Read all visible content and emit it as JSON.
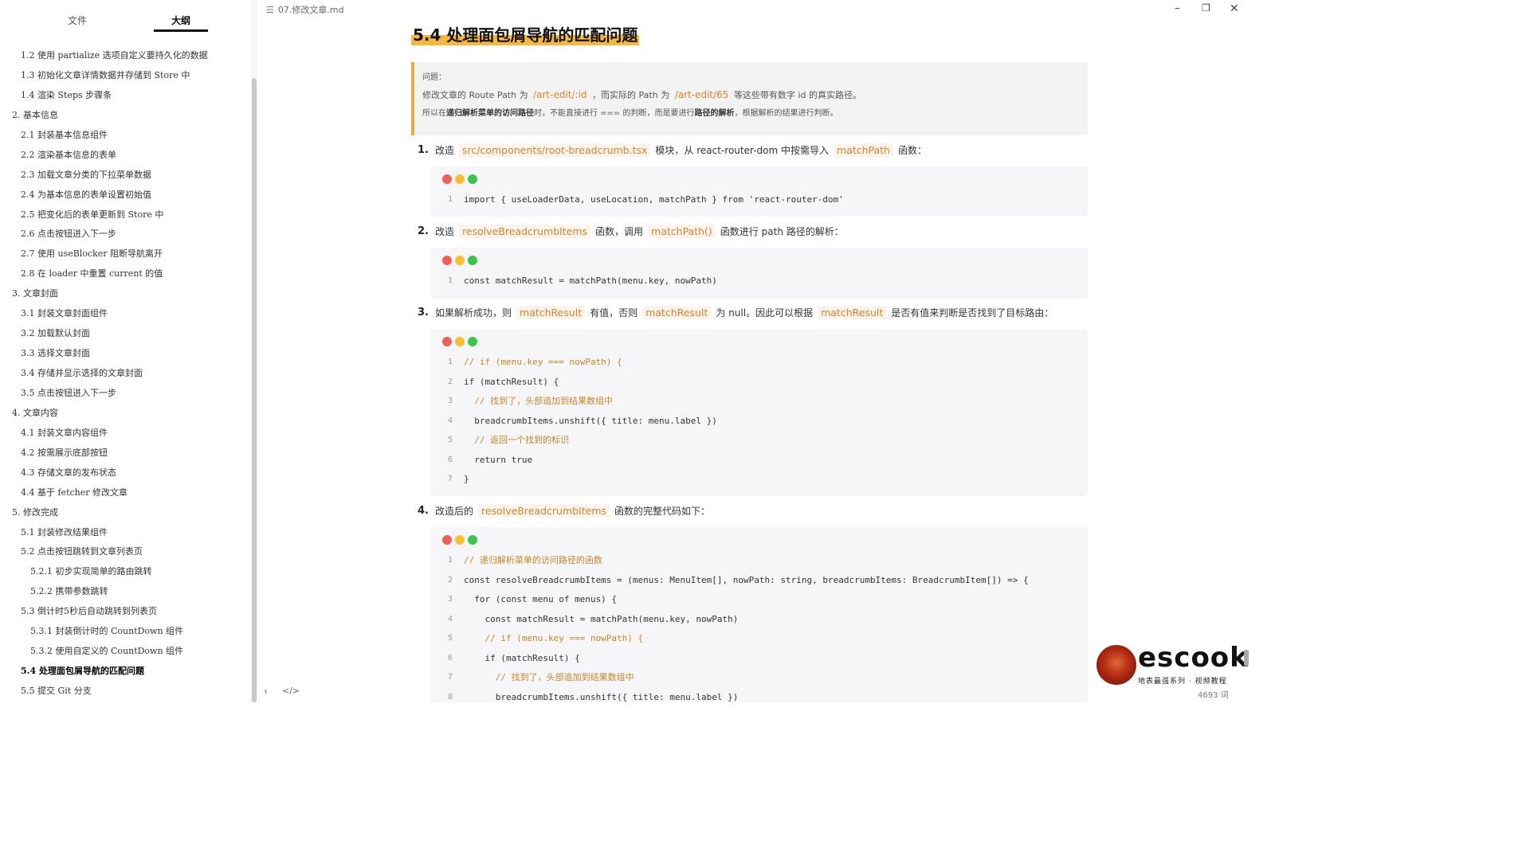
{
  "titlebar": {
    "file_name": "07.修改文章.md",
    "minimize_glyph": "–",
    "maximize_glyph": "❐",
    "close_glyph": "✕"
  },
  "sidebar": {
    "tab_files": "文件",
    "tab_outline": "大纲",
    "items": [
      {
        "label": "1.2 使用 partialize 选项自定义要持久化的数据",
        "level": 2
      },
      {
        "label": "1.3 初始化文章详情数据并存储到 Store 中",
        "level": 2
      },
      {
        "label": "1.4 渲染 Steps 步骤条",
        "level": 2
      },
      {
        "label": "2. 基本信息",
        "level": 1
      },
      {
        "label": "2.1 封装基本信息组件",
        "level": 2
      },
      {
        "label": "2.2 渲染基本信息的表单",
        "level": 2
      },
      {
        "label": "2.3 加载文章分类的下拉菜单数据",
        "level": 2
      },
      {
        "label": "2.4 为基本信息的表单设置初始值",
        "level": 2
      },
      {
        "label": "2.5 把变化后的表单更新到 Store 中",
        "level": 2
      },
      {
        "label": "2.6 点击按钮进入下一步",
        "level": 2
      },
      {
        "label": "2.7 使用 useBlocker 阻断导航离开",
        "level": 2
      },
      {
        "label": "2.8 在 loader 中重置 current 的值",
        "level": 2
      },
      {
        "label": "3. 文章封面",
        "level": 1
      },
      {
        "label": "3.1 封装文章封面组件",
        "level": 2
      },
      {
        "label": "3.2 加载默认封面",
        "level": 2
      },
      {
        "label": "3.3 选择文章封面",
        "level": 2
      },
      {
        "label": "3.4 存储并显示选择的文章封面",
        "level": 2
      },
      {
        "label": "3.5 点击按钮进入下一步",
        "level": 2
      },
      {
        "label": "4. 文章内容",
        "level": 1
      },
      {
        "label": "4.1 封装文章内容组件",
        "level": 2
      },
      {
        "label": "4.2 按需展示底部按钮",
        "level": 2
      },
      {
        "label": "4.3 存储文章的发布状态",
        "level": 2
      },
      {
        "label": "4.4 基于 fetcher 修改文章",
        "level": 2
      },
      {
        "label": "5. 修改完成",
        "level": 1
      },
      {
        "label": "5.1 封装修改结果组件",
        "level": 2
      },
      {
        "label": "5.2 点击按钮跳转到文章列表页",
        "level": 2
      },
      {
        "label": "5.2.1 初步实现简单的路由跳转",
        "level": 3
      },
      {
        "label": "5.2.2 携带参数跳转",
        "level": 3
      },
      {
        "label": "5.3 倒计时5秒后自动跳转到列表页",
        "level": 2
      },
      {
        "label": "5.3.1 封装倒计时的 CountDown 组件",
        "level": 3
      },
      {
        "label": "5.3.2 使用自定义的 CountDown 组件",
        "level": 3
      },
      {
        "label": "5.4 处理面包屑导航的匹配问题",
        "level": 2,
        "active": true
      },
      {
        "label": "5.5 提交 Git 分支",
        "level": 2
      }
    ]
  },
  "doc": {
    "heading": "5.4 处理面包屑导航的匹配问题",
    "callout": {
      "title": "问题：",
      "line2_a": "修改文章的 Route Path 为",
      "line2_path1": "/art-edit/:id",
      "line2_b": "，而实际的 Path 为",
      "line2_path2": "/art-edit/65",
      "line2_c": "等这些带有数字 id 的真实路径。",
      "line3_a": "所以在",
      "line3_b": "递归解析菜单的访问路径",
      "line3_c": "时，不能直接进行 === 的判断，而是要进行",
      "line3_d": "路径的解析",
      "line3_e": "，根据解析的结果进行判断。"
    },
    "step1": {
      "num": "1.",
      "a": "改造",
      "code1": "src/components/root-breadcrumb.tsx",
      "b": "模块，从",
      "c": "react-router-dom",
      "d": "中按需导入",
      "code2": "matchPath",
      "e": "函数："
    },
    "code1": [
      {
        "n": "1",
        "t": "import { useLoaderData, useLocation, matchPath } from 'react-router-dom'"
      }
    ],
    "step2": {
      "num": "2.",
      "a": "改造",
      "code1": "resolveBreadcrumbItems",
      "b": "函数，调用",
      "code2": "matchPath()",
      "c": "函数进行",
      "d": "path",
      "e": "路径的解析："
    },
    "code2": [
      {
        "n": "1",
        "t": "const matchResult = matchPath(menu.key, nowPath)"
      }
    ],
    "step3": {
      "num": "3.",
      "a": "如果解析成功，则",
      "code1": "matchResult",
      "b": "有值，否则",
      "code2": "matchResult",
      "c": "为",
      "d": "null",
      "e": "。因此可以根据",
      "code3": "matchResult",
      "f": "是否有值来判断是否找到了目标路由："
    },
    "code3": [
      {
        "n": "1",
        "t": "// if (menu.key === nowPath) {",
        "comment": true
      },
      {
        "n": "2",
        "t": "if (matchResult) {"
      },
      {
        "n": "3",
        "t": "  // 找到了，头部追加到结果数组中",
        "comment": true
      },
      {
        "n": "4",
        "t": "  breadcrumbItems.unshift({ title: menu.label })"
      },
      {
        "n": "5",
        "t": "  // 返回一个找到的标识",
        "comment": true
      },
      {
        "n": "6",
        "t": "  return true"
      },
      {
        "n": "7",
        "t": "}"
      }
    ],
    "step4": {
      "num": "4.",
      "a": "改造后的",
      "code1": "resolveBreadcrumbItems",
      "b": "函数的完整代码如下："
    },
    "code4": [
      {
        "n": "1",
        "t": "// 递归解析菜单的访问路径的函数",
        "comment": true
      },
      {
        "n": "2",
        "t": "const resolveBreadcrumbItems = (menus: MenuItem[], nowPath: string, breadcrumbItems: BreadcrumbItem[]) => {"
      },
      {
        "n": "3",
        "t": "  for (const menu of menus) {"
      },
      {
        "n": "4",
        "t": "    const matchResult = matchPath(menu.key, nowPath)"
      },
      {
        "n": "5",
        "t": "    // if (menu.key === nowPath) {",
        "comment": true
      },
      {
        "n": "6",
        "t": "    if (matchResult) {"
      },
      {
        "n": "7",
        "t": "      // 找到了，头部追加到结果数组中",
        "comment": true
      },
      {
        "n": "8",
        "t": "      breadcrumbItems.unshift({ title: menu.label })"
      }
    ]
  },
  "footer": {
    "collapse_glyph": "‹",
    "source_glyph": "</>",
    "word_count": "4693 词",
    "logo_text": "escook",
    "logo_sub": "地表最强系列 · 视频教程"
  },
  "colors": {
    "accent": "#d9822b",
    "highlight": "#f6b73c",
    "callout_bg": "#f3f3f4",
    "code_bg": "#f6f6f8"
  }
}
